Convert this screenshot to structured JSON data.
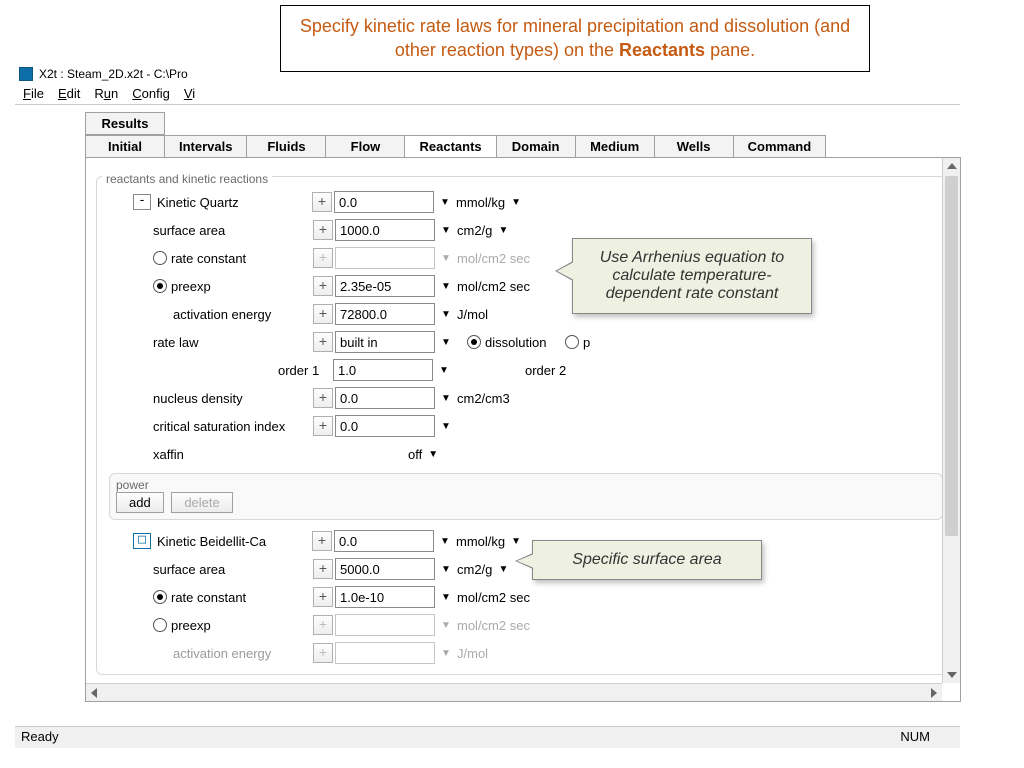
{
  "banner": {
    "pre": "Specify kinetic rate laws for mineral precipitation and dissolution (and other reaction types) on the ",
    "bold": "Reactants",
    "post": " pane."
  },
  "window": {
    "title": "X2t : Steam_2D.x2t - C:\\Pro"
  },
  "menu": [
    "File",
    "Edit",
    "Run",
    "Config",
    "View"
  ],
  "tabs": {
    "upper": "Results",
    "row": [
      "Initial",
      "Intervals",
      "Fluids",
      "Flow",
      "Reactants",
      "Domain",
      "Medium",
      "Wells",
      "Command"
    ],
    "active": "Reactants"
  },
  "fieldset_label": "reactants and kinetic reactions",
  "quartz": {
    "title": "Kinetic  Quartz",
    "amount": "0.0",
    "amount_unit": "mmol/kg",
    "surface_area_label": "surface area",
    "surface_area": "1000.0",
    "surface_area_unit": "cm2/g",
    "rate_const_label": "rate constant",
    "rate_const_unit": "mol/cm2 sec",
    "preexp_label": "preexp",
    "preexp": "2.35e-05",
    "preexp_unit": "mol/cm2 sec",
    "act_energy_label": "activation energy",
    "act_energy": "72800.0",
    "act_energy_unit": "J/mol",
    "rate_law_label": "rate law",
    "rate_law": "built in",
    "dissolution": "dissolution",
    "p": "p",
    "order1_label": "order 1",
    "order1": "1.0",
    "order2_label": "order 2",
    "nucleus_label": "nucleus density",
    "nucleus": "0.0",
    "nucleus_unit": "cm2/cm3",
    "csi_label": "critical saturation index",
    "csi": "0.0",
    "xaffin_label": "xaffin",
    "xaffin_value": "off"
  },
  "power": {
    "label": "power",
    "add": "add",
    "delete": "delete"
  },
  "beidellit": {
    "title": "Kinetic  Beidellit-Ca",
    "amount": "0.0",
    "amount_unit": "mmol/kg",
    "surface_area_label": "surface area",
    "surface_area": "5000.0",
    "surface_area_unit": "cm2/g",
    "rate_const_label": "rate constant",
    "rate_const": "1.0e-10",
    "rate_const_unit": "mol/cm2 sec",
    "preexp_label": "preexp",
    "preexp_unit": "mol/cm2 sec",
    "act_energy_label": "activation energy",
    "act_energy_unit": "J/mol"
  },
  "callouts": {
    "arrhenius": "Use Arrhenius equation to calculate temperature-dependent rate constant",
    "ssa": "Specific surface area"
  },
  "status": {
    "left": "Ready",
    "right": "NUM"
  }
}
